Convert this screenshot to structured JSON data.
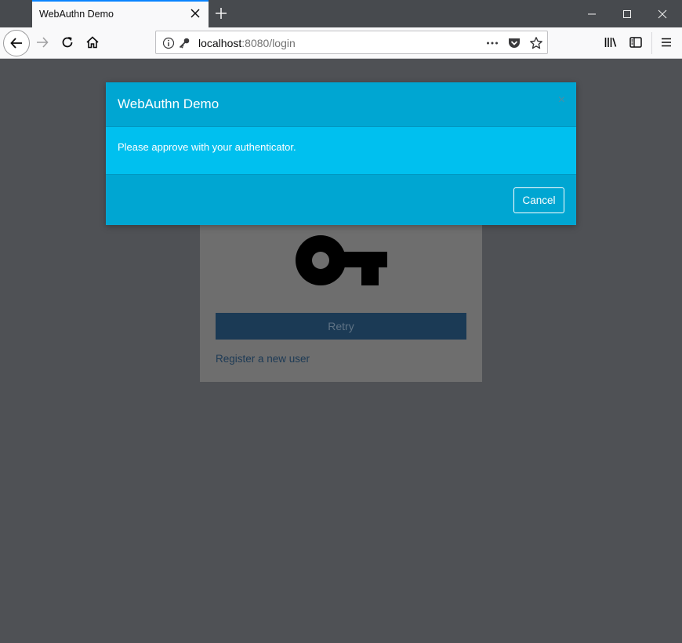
{
  "browser": {
    "tab_title": "WebAuthn Demo",
    "url_host": "localhost",
    "url_rest": ":8080/login"
  },
  "page": {
    "retry_label": "Retry",
    "register_link": "Register a new user",
    "key_icon": "key-icon"
  },
  "modal": {
    "title": "WebAuthn Demo",
    "close_glyph": "×",
    "message": "Please approve with your authenticator.",
    "cancel_label": "Cancel"
  },
  "colors": {
    "modal_header": "#00a6d2",
    "modal_body": "#00c0ef",
    "retry_button": "#1b3a55",
    "page_backdrop": "#4f5155"
  }
}
